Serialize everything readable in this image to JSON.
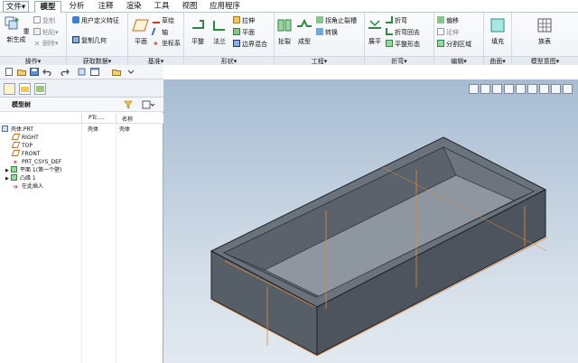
{
  "tabs": [
    {
      "label": "文件▾"
    },
    {
      "label": "模型"
    },
    {
      "label": "分析"
    },
    {
      "label": "注释"
    },
    {
      "label": "渲染"
    },
    {
      "label": "工具"
    },
    {
      "label": "视图"
    },
    {
      "label": "应用程序"
    }
  ],
  "ribbon": {
    "ops": {
      "label": "操作▾",
      "regen": "重新生成",
      "copy": "复制",
      "paste": "粘贴▾",
      "delete": "删除▾"
    },
    "getdata": {
      "label": "获取数据▾",
      "udf": "用户定义特征",
      "copygeom": "复制几何"
    },
    "datum": {
      "label": "基准▾",
      "plane": "平面",
      "axis_label": "草绘",
      "axis": "轴",
      "csys": "坐标系"
    },
    "shape": {
      "label": "形状▾",
      "flat": "平整",
      "flange": "法兰",
      "extrude": "拉伸",
      "plane2": "平面",
      "boundary": "边界混合"
    },
    "eng": {
      "label": "工程▾",
      "rip": "扯裂",
      "form": "成型",
      "corner": "拐角止裂槽",
      "convert": "转换"
    },
    "bend": {
      "label": "折弯▾",
      "unbend": "展平",
      "bend": "折弯",
      "bendback": "折弯回去",
      "flatform": "平整形态"
    },
    "edit": {
      "label": "编辑▾",
      "offset": "偏移",
      "extend": "延伸",
      "split": "分割区域"
    },
    "surface": {
      "label": "曲面▾",
      "fill": "填充"
    },
    "intent": {
      "label": "模型意图▾",
      "table": "族表"
    }
  },
  "panel": {
    "title": "模型树",
    "col_id": "PTc....",
    "col_name": "名称",
    "items": [
      {
        "label": "壳体.PRT",
        "c1": "壳体",
        "c2": "壳体"
      },
      {
        "label": "RIGHT"
      },
      {
        "label": "TOP"
      },
      {
        "label": "FRONT"
      },
      {
        "label": "PRT_CSYS_DEF"
      },
      {
        "label": "平面 1(第一个壁)"
      },
      {
        "label": "凸缘 1"
      },
      {
        "label": "在此插入"
      }
    ]
  },
  "colors": {
    "accent": "#2a6ebb",
    "model": "#555d66",
    "edge": "#e08a38"
  }
}
